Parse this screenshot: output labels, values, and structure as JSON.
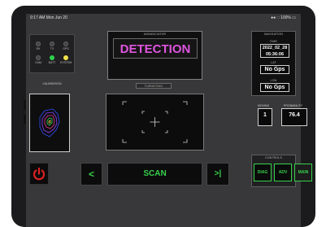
{
  "status_bar": {
    "time": "9:17 AM  Mon Jun 20",
    "indicators": "●● ∷ 100% ▭"
  },
  "status_panel": {
    "leds": [
      {
        "label": "RX",
        "color": "#444444"
      },
      {
        "label": "TX",
        "color": "#444444"
      },
      {
        "label": "GPS",
        "color": "#444444"
      },
      {
        "label": "CAM",
        "color": "#444444"
      },
      {
        "label": "BATT",
        "color": "#2fd24a"
      },
      {
        "label": "SYSTEM",
        "color": "#f2e34a"
      }
    ]
  },
  "calibration": {
    "title": "CALIBRATION"
  },
  "annunciator": {
    "title": "ANNUNCIATOR",
    "message": "DETECTION",
    "message_color": "#e055e0"
  },
  "targeting": {
    "title": "TURGETING"
  },
  "navigation": {
    "title": "NAVIGATION",
    "time_label": "TIME",
    "time_date": "2022_02_28",
    "time_clock": "05:36:06",
    "lat_label": "LAT",
    "lat_value": "No Gps",
    "lon_label": "LON",
    "lon_value": "No Gps"
  },
  "readouts": {
    "moving_label": "MOVING",
    "moving_value": "1",
    "probability_label": "PROBABILITY",
    "probability_value": "76.4"
  },
  "controls": {
    "title": "CONTROLS",
    "buttons": [
      "DIAG",
      "ADV",
      "MAIN"
    ]
  },
  "bottom_bar": {
    "prev_label": "<",
    "scan_label": "SCAN",
    "next_label": ">|"
  },
  "colors": {
    "accent_green": "#37d14b",
    "power_red": "#e02020",
    "background": "#38383a"
  }
}
